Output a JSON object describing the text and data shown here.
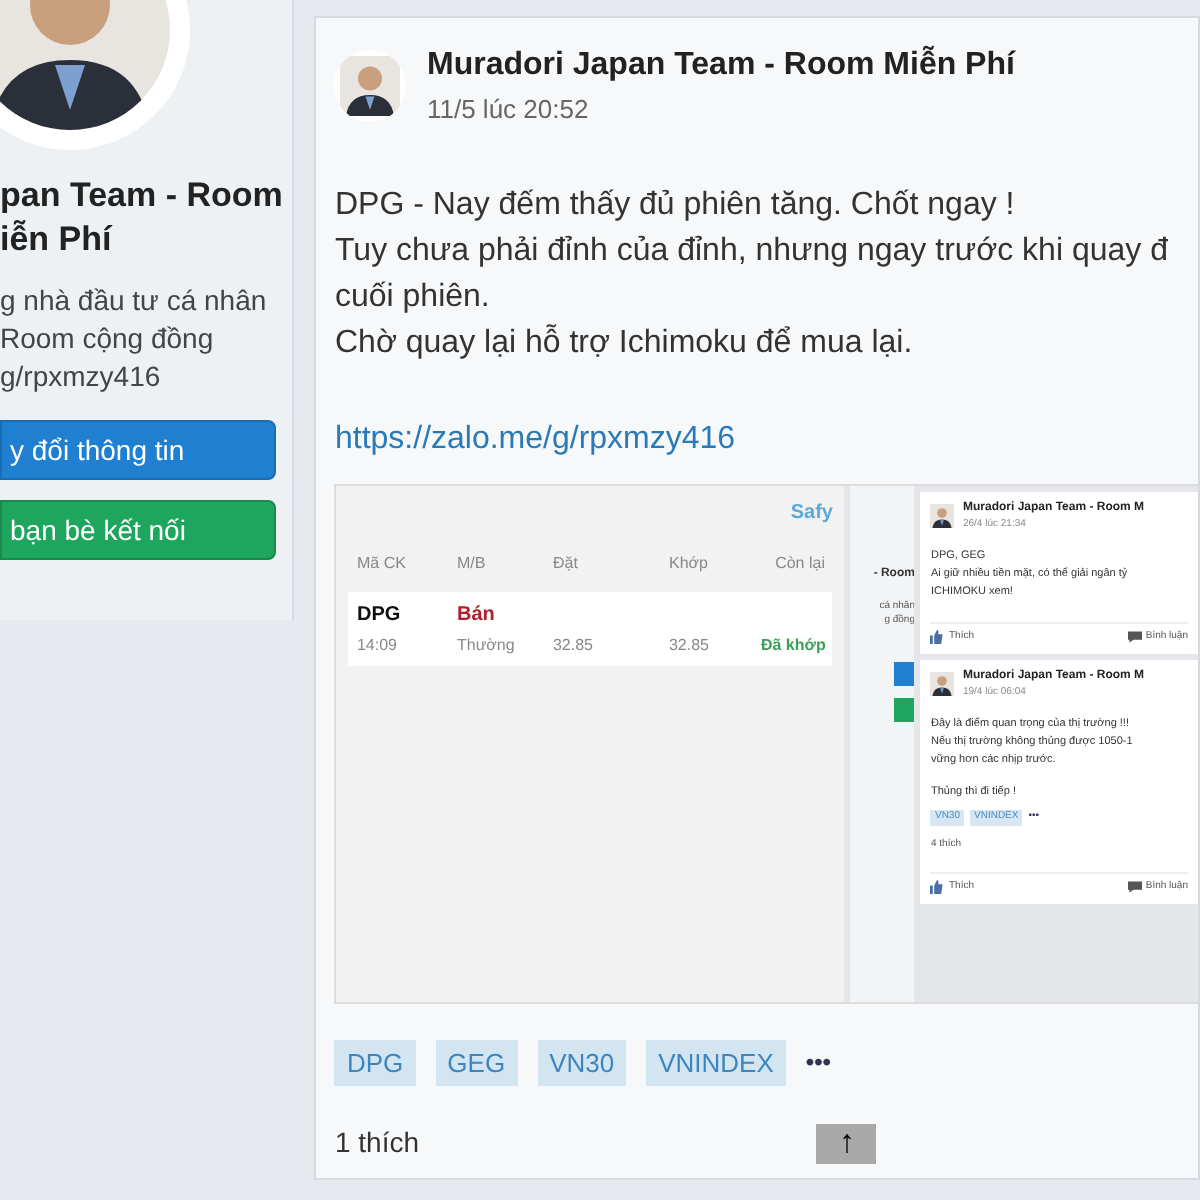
{
  "sidebar": {
    "title_lines": [
      "pan Team - Room",
      "iễn Phí"
    ],
    "description_lines": [
      "g nhà đầu tư cá nhân",
      "Room cộng đồng",
      "g/rpxmzy416"
    ],
    "buttons": [
      {
        "label": "y đổi thông tin",
        "kind": "primary"
      },
      {
        "label": "bạn bè kết nối",
        "kind": "success"
      }
    ]
  },
  "post": {
    "author": "Muradori Japan Team - Room Miễn Phí",
    "time": "11/5 lúc 20:52",
    "body_lines": [
      "DPG - Nay đếm thấy đủ phiên tăng. Chốt ngay !",
      "Tuy chưa phải đỉnh của đỉnh, nhưng ngay trước khi quay đ",
      "cuối phiên.",
      "Chờ quay lại hỗ trợ Ichimoku để mua lại."
    ],
    "link": "https://zalo.me/g/rpxmzy416",
    "image": {
      "order_panel": {
        "brand": "Safy",
        "columns": [
          "Mã CK",
          "M/B",
          "Đặt",
          "Khớp",
          "Còn lại"
        ],
        "orders": [
          {
            "symbol": "DPG",
            "side": "Bán",
            "time": "14:09",
            "type": "Thường",
            "price": "32.85",
            "matched": "32.85",
            "status": "Đã khớp"
          }
        ]
      },
      "profile_strip": [
        "- Room",
        "cá nhân",
        "g  đồng"
      ],
      "feed": [
        {
          "author": "Muradori Japan Team - Room M",
          "time": "26/4 lúc 21:34",
          "paragraphs": [
            [
              "DPG, GEG",
              "Ai giữ nhiều tiền mặt, có thể giải ngân tỷ",
              "ICHIMOKU xem!"
            ]
          ],
          "actions": [
            "Thích",
            "Bình luận"
          ]
        },
        {
          "author": "Muradori Japan Team - Room M",
          "time": "19/4 lúc 06:04",
          "paragraphs": [
            [
              "Đây là điểm quan trọng của thị trường !!!",
              "Nếu thị trường không thủng được 1050-1",
              "vững hơn các nhịp trước."
            ],
            [
              "Thủng thì đi tiếp !"
            ]
          ],
          "tags": [
            "VN30",
            "VNINDEX"
          ],
          "more": "•••",
          "likes": "4 thích",
          "actions": [
            "Thích",
            "Bình luận"
          ]
        }
      ]
    },
    "tags": [
      "DPG",
      "GEG",
      "VN30",
      "VNINDEX"
    ],
    "more": "•••",
    "likes": "1 thích"
  },
  "scroll_top_button": "↑"
}
